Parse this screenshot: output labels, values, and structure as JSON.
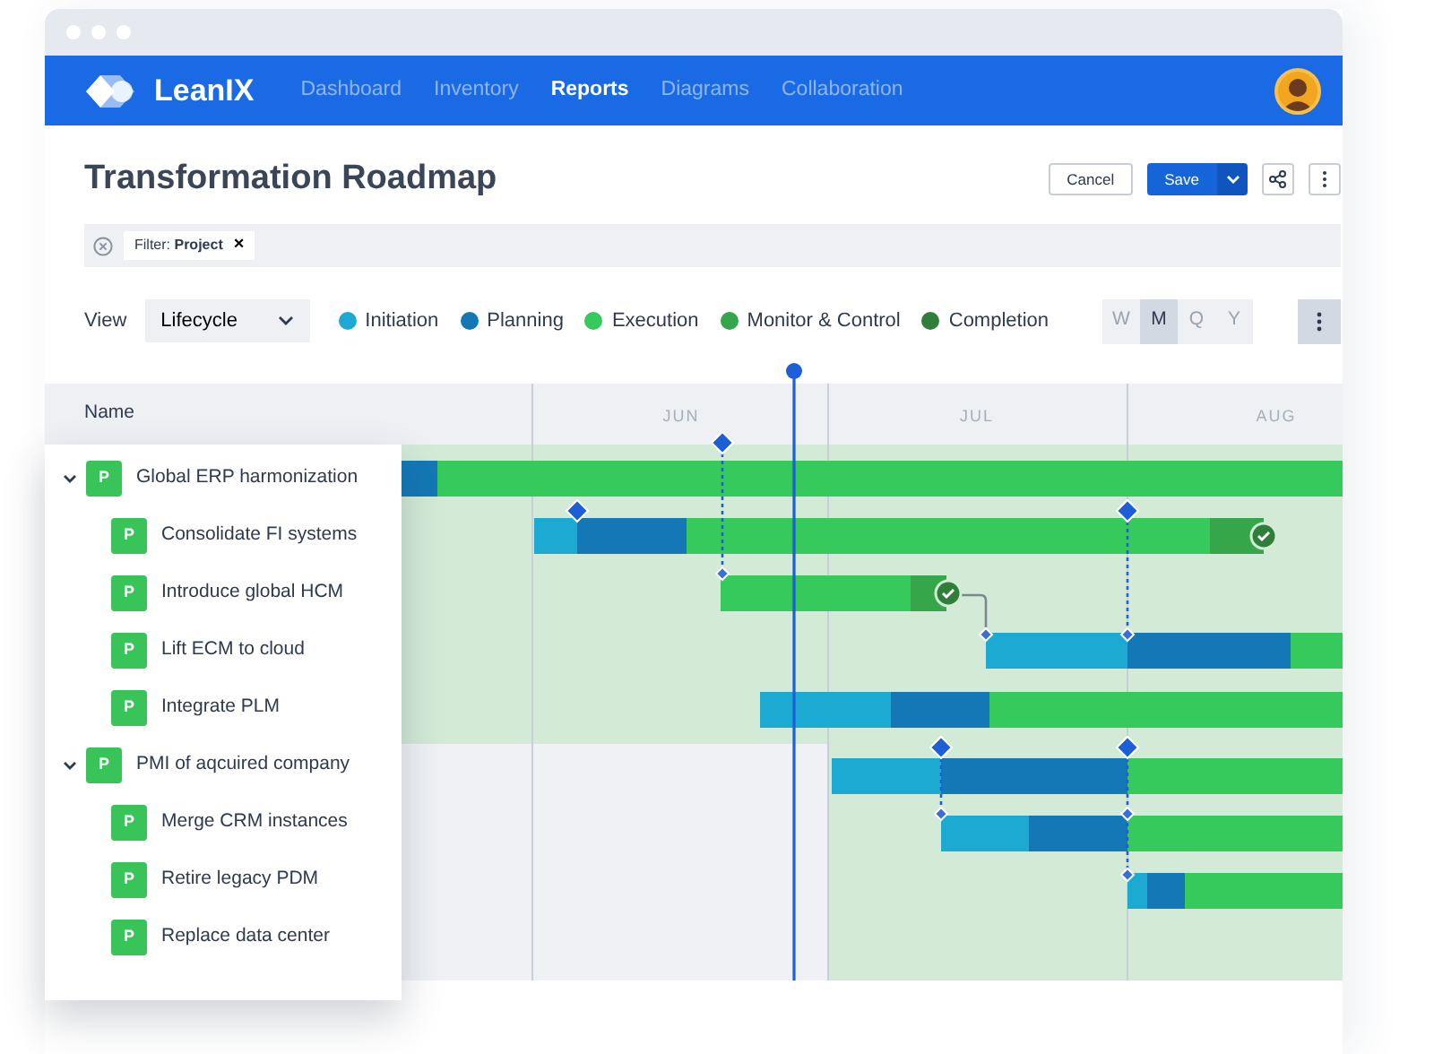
{
  "app": {
    "brand": "LeanIX",
    "nav": [
      {
        "label": "Dashboard",
        "selected": false
      },
      {
        "label": "Inventory",
        "selected": false
      },
      {
        "label": "Reports",
        "selected": true
      },
      {
        "label": "Diagrams",
        "selected": false
      },
      {
        "label": "Collaboration",
        "selected": false
      }
    ]
  },
  "page": {
    "title": "Transformation Roadmap",
    "buttons": [
      {
        "label": "Cancel",
        "kind": "outline"
      },
      {
        "label": "Save",
        "kind": "primary"
      }
    ]
  },
  "filter": {
    "text": "Filter: **Project**",
    "remove": "×"
  },
  "view": {
    "label": "View",
    "value": "Lifecycle"
  },
  "legend": [
    {
      "label": "Initiation",
      "color": "#1ca9d2"
    },
    {
      "label": "Planning",
      "color": "#1378b5"
    },
    {
      "label": "Execution",
      "color": "#36c95b"
    },
    {
      "label": "Monitor & Control",
      "color": "#35a64a"
    },
    {
      "label": "Completion",
      "color": "#2f7f3b"
    }
  ],
  "zoom": [
    {
      "label": "W",
      "selected": false
    },
    {
      "label": "M",
      "selected": true
    },
    {
      "label": "Q",
      "selected": false
    },
    {
      "label": "Y",
      "selected": false
    }
  ],
  "gantt": {
    "name_header": "Name",
    "months": [
      "JUN",
      "JUL",
      "AUG"
    ],
    "rows": [
      {
        "name": "Global ERP harmonization",
        "badge": "P",
        "expanded": true,
        "children": [
          {
            "name": "Consolidate FI systems",
            "badge": "P"
          },
          {
            "name": "Introduce global HCM",
            "badge": "P"
          },
          {
            "name": "Lift ECM to cloud",
            "badge": "P"
          },
          {
            "name": "Integrate PLM",
            "badge": "P"
          }
        ]
      },
      {
        "name": "PMI of aqcuired company",
        "badge": "P",
        "expanded": true,
        "children": [
          {
            "name": "Merge CRM instances",
            "badge": "P"
          },
          {
            "name": "Retire legacy PDM",
            "badge": "P"
          },
          {
            "name": "Replace data center",
            "badge": "P"
          }
        ]
      }
    ]
  }
}
